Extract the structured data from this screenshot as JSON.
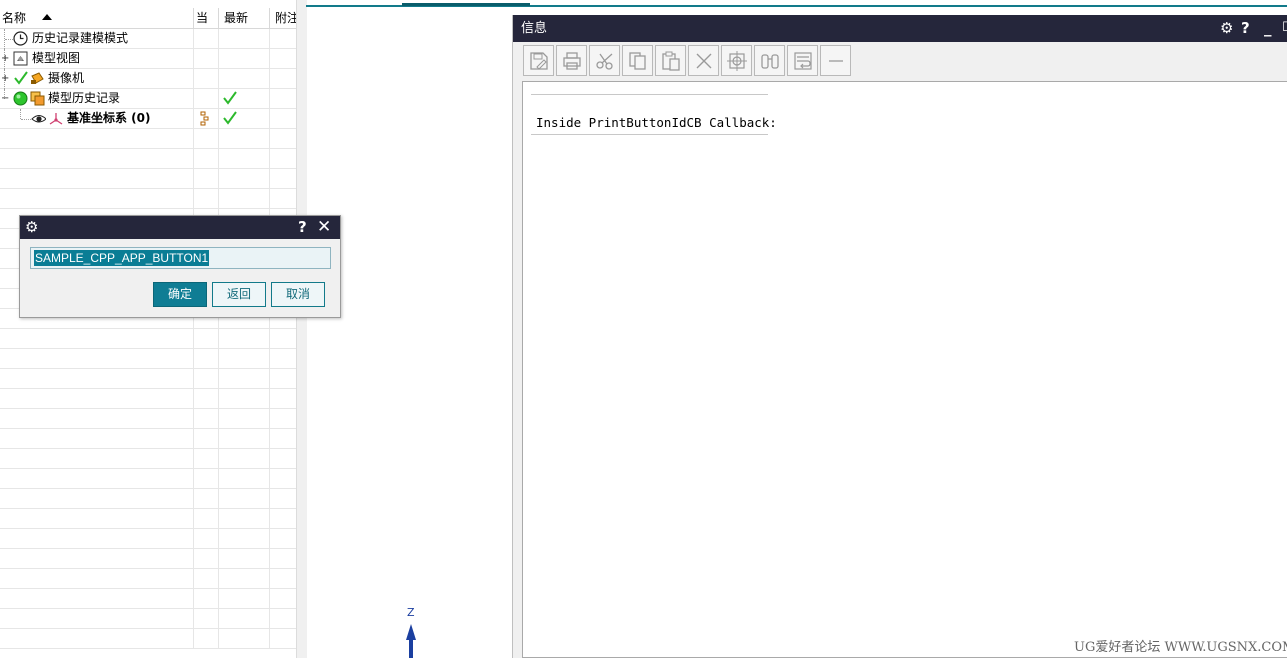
{
  "navigator": {
    "columns": [
      "名称",
      "当",
      "最新",
      "附注"
    ],
    "nodes": [
      {
        "label": "历史记录建模模式",
        "bold": false
      },
      {
        "label": "模型视图",
        "bold": false,
        "expander": "+"
      },
      {
        "label": "摄像机",
        "bold": false,
        "expander": "+"
      },
      {
        "label": "模型历史记录",
        "bold": false,
        "expander": "−"
      },
      {
        "label": "基准坐标系 (0)",
        "bold": true
      }
    ]
  },
  "graphics": {
    "z_axis_label": "Z"
  },
  "info_window": {
    "title": "信息",
    "title_icons": [
      "gear-icon",
      "help-icon",
      "minimize-icon",
      "maximize-icon"
    ],
    "toolbar": [
      "save-icon",
      "print-icon",
      "cut-icon",
      "copy-icon",
      "paste-icon",
      "delete-icon",
      "target-icon",
      "binoculars-icon",
      "wrap-icon",
      "minus-icon"
    ],
    "body_text": "Inside PrintButtonIdCB Callback:"
  },
  "dialog": {
    "input_value": "SAMPLE_CPP_APP_BUTTON1",
    "ok_label": "确定",
    "back_label": "返回",
    "cancel_label": "取消"
  },
  "watermark": "UG爱好者论坛 WWW.UGSNX.COM",
  "colors": {
    "title_bar": "#25263b",
    "accent": "#0f7d94",
    "check": "#2db92d"
  }
}
